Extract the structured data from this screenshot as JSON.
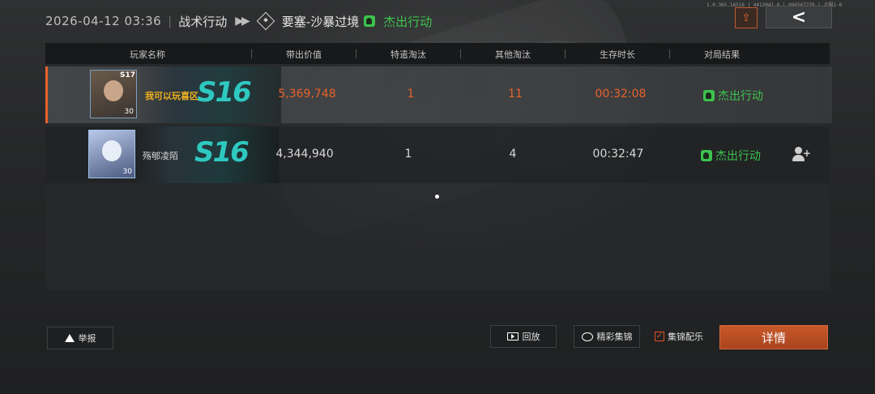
{
  "header": {
    "datetime": "2026-04-12 03:36",
    "mode": "战术行动",
    "map": "要塞-沙暴过境",
    "result": "杰出行动"
  },
  "version_text": "1.0.365.16516 | 4412041 0 | 996567270 | 点服1-6",
  "columns": {
    "player": "玩家名称",
    "value": "带出价值",
    "targeted": "特遣淘汰",
    "other": "其他淘汰",
    "survival": "生存时长",
    "result": "对局结果"
  },
  "players": [
    {
      "name": "我可以玩喜区",
      "avatar_season": "S17",
      "level": "30",
      "banner": "S16",
      "value": "5,369,748",
      "targeted": "1",
      "other": "11",
      "survival": "00:32:08",
      "result": "杰出行动",
      "highlighted": true
    },
    {
      "name": "殇郇凌陌",
      "avatar_season": "",
      "level": "30",
      "banner": "S16",
      "value": "4,344,940",
      "targeted": "1",
      "other": "4",
      "survival": "00:32:47",
      "result": "杰出行动",
      "highlighted": false
    }
  ],
  "buttons": {
    "report": "举报",
    "replay": "回放",
    "highlights": "精彩集锦",
    "music_label": "集锦配乐",
    "music_checked": true,
    "details": "详情"
  },
  "colors": {
    "accent": "#e8622a",
    "success": "#3dc24e",
    "highlight_name": "#f0b020"
  },
  "icons": [
    "share-icon",
    "back-chevron-icon",
    "map-diamond-icon",
    "result-leaf-icon",
    "add-friend-icon",
    "warning-icon",
    "replay-film-icon",
    "highlight-reel-icon",
    "checkbox-check-icon"
  ]
}
